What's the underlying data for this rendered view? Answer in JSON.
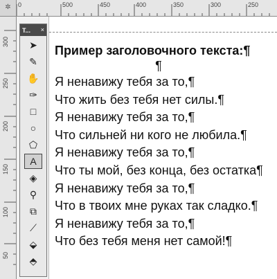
{
  "ruler": {
    "corner_label": "✲",
    "horizontal_labels": [
      "0",
      "500",
      "450",
      "400",
      "350",
      "300",
      "250"
    ],
    "vertical_labels": [
      "300",
      "250",
      "200",
      "150",
      "100",
      "50"
    ]
  },
  "toolbox": {
    "title_label": "T...",
    "close_glyph": "×",
    "tools": [
      {
        "name": "pick-tool",
        "glyph": "➤"
      },
      {
        "name": "shape-tool",
        "glyph": "✎"
      },
      {
        "name": "pan-tool",
        "glyph": "✋"
      },
      {
        "name": "freehand-tool",
        "glyph": "✑"
      },
      {
        "name": "rectangle-tool",
        "glyph": "□"
      },
      {
        "name": "ellipse-tool",
        "glyph": "○"
      },
      {
        "name": "polygon-tool",
        "glyph": "⬠"
      },
      {
        "name": "text-tool",
        "glyph": "A"
      },
      {
        "name": "fill-tool",
        "glyph": "◈"
      },
      {
        "name": "outline-tool",
        "glyph": "⚲"
      },
      {
        "name": "interactive-tool",
        "glyph": "⧉"
      },
      {
        "name": "eyedropper-tool",
        "glyph": "⟋"
      },
      {
        "name": "bucket-tool",
        "glyph": "⬙"
      },
      {
        "name": "smart-fill-tool",
        "glyph": "⬘"
      }
    ]
  },
  "document": {
    "heading": "Пример заголовочного текста:¶",
    "pilcrow": "¶",
    "lines": [
      "Я ненавижу тебя за то,¶",
      "Что жить без тебя нет силы.¶",
      "Я ненавижу тебя за то,¶",
      "Что сильней ни кого не любила.¶",
      "Я ненавижу тебя за то,¶",
      "Что ты мой, без конца, без остатка¶",
      "Я ненавижу тебя за то,¶",
      "Что в твоих мне руках так сладко.¶",
      "Я ненавижу тебя за то,¶",
      "Что без тебя меня нет самой!¶"
    ]
  }
}
